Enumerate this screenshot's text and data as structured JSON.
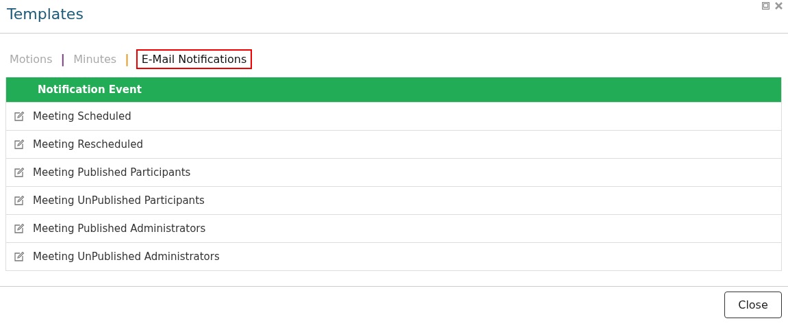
{
  "window": {
    "title": "Templates"
  },
  "tabs": [
    {
      "label": "Motions",
      "selected": false,
      "separator": "|",
      "color": "#7b3f7f"
    },
    {
      "label": "Minutes",
      "selected": false,
      "separator": "|",
      "color": "#e0a030"
    },
    {
      "label": "E-Mail Notifications",
      "selected": true
    }
  ],
  "table": {
    "columns": [
      "Notification Event"
    ],
    "rows": [
      "Meeting Scheduled",
      "Meeting Rescheduled",
      "Meeting Published Participants",
      "Meeting UnPublished Participants",
      "Meeting Published Administrators",
      "Meeting UnPublished Administrators"
    ]
  },
  "buttons": [
    "Close"
  ]
}
